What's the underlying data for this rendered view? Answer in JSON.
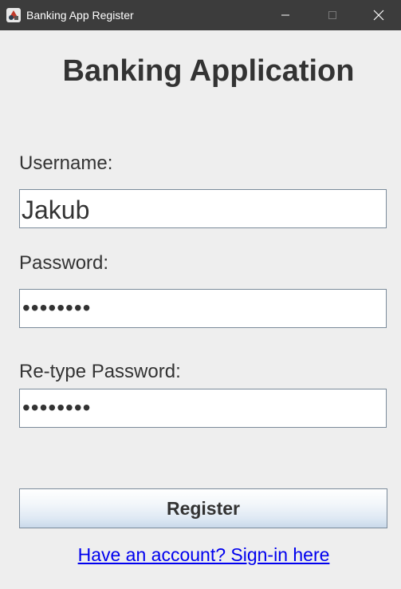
{
  "window": {
    "title": "Banking App Register",
    "icon": "app-icon",
    "controls": [
      "minimize-icon",
      "maximize-icon",
      "close-icon"
    ]
  },
  "form": {
    "heading": "Banking Application",
    "username_label": "Username:",
    "username_value": "Jakub",
    "password_label": "Password:",
    "password_value": "••••••••",
    "retype_label": "Re-type Password:",
    "retype_value": "••••••••",
    "register_button": "Register",
    "signin_link": "Have an account? Sign-in here"
  },
  "colors": {
    "titlebar": "#3c3c3c",
    "background": "#eeeeee",
    "link": "#0000ee"
  }
}
